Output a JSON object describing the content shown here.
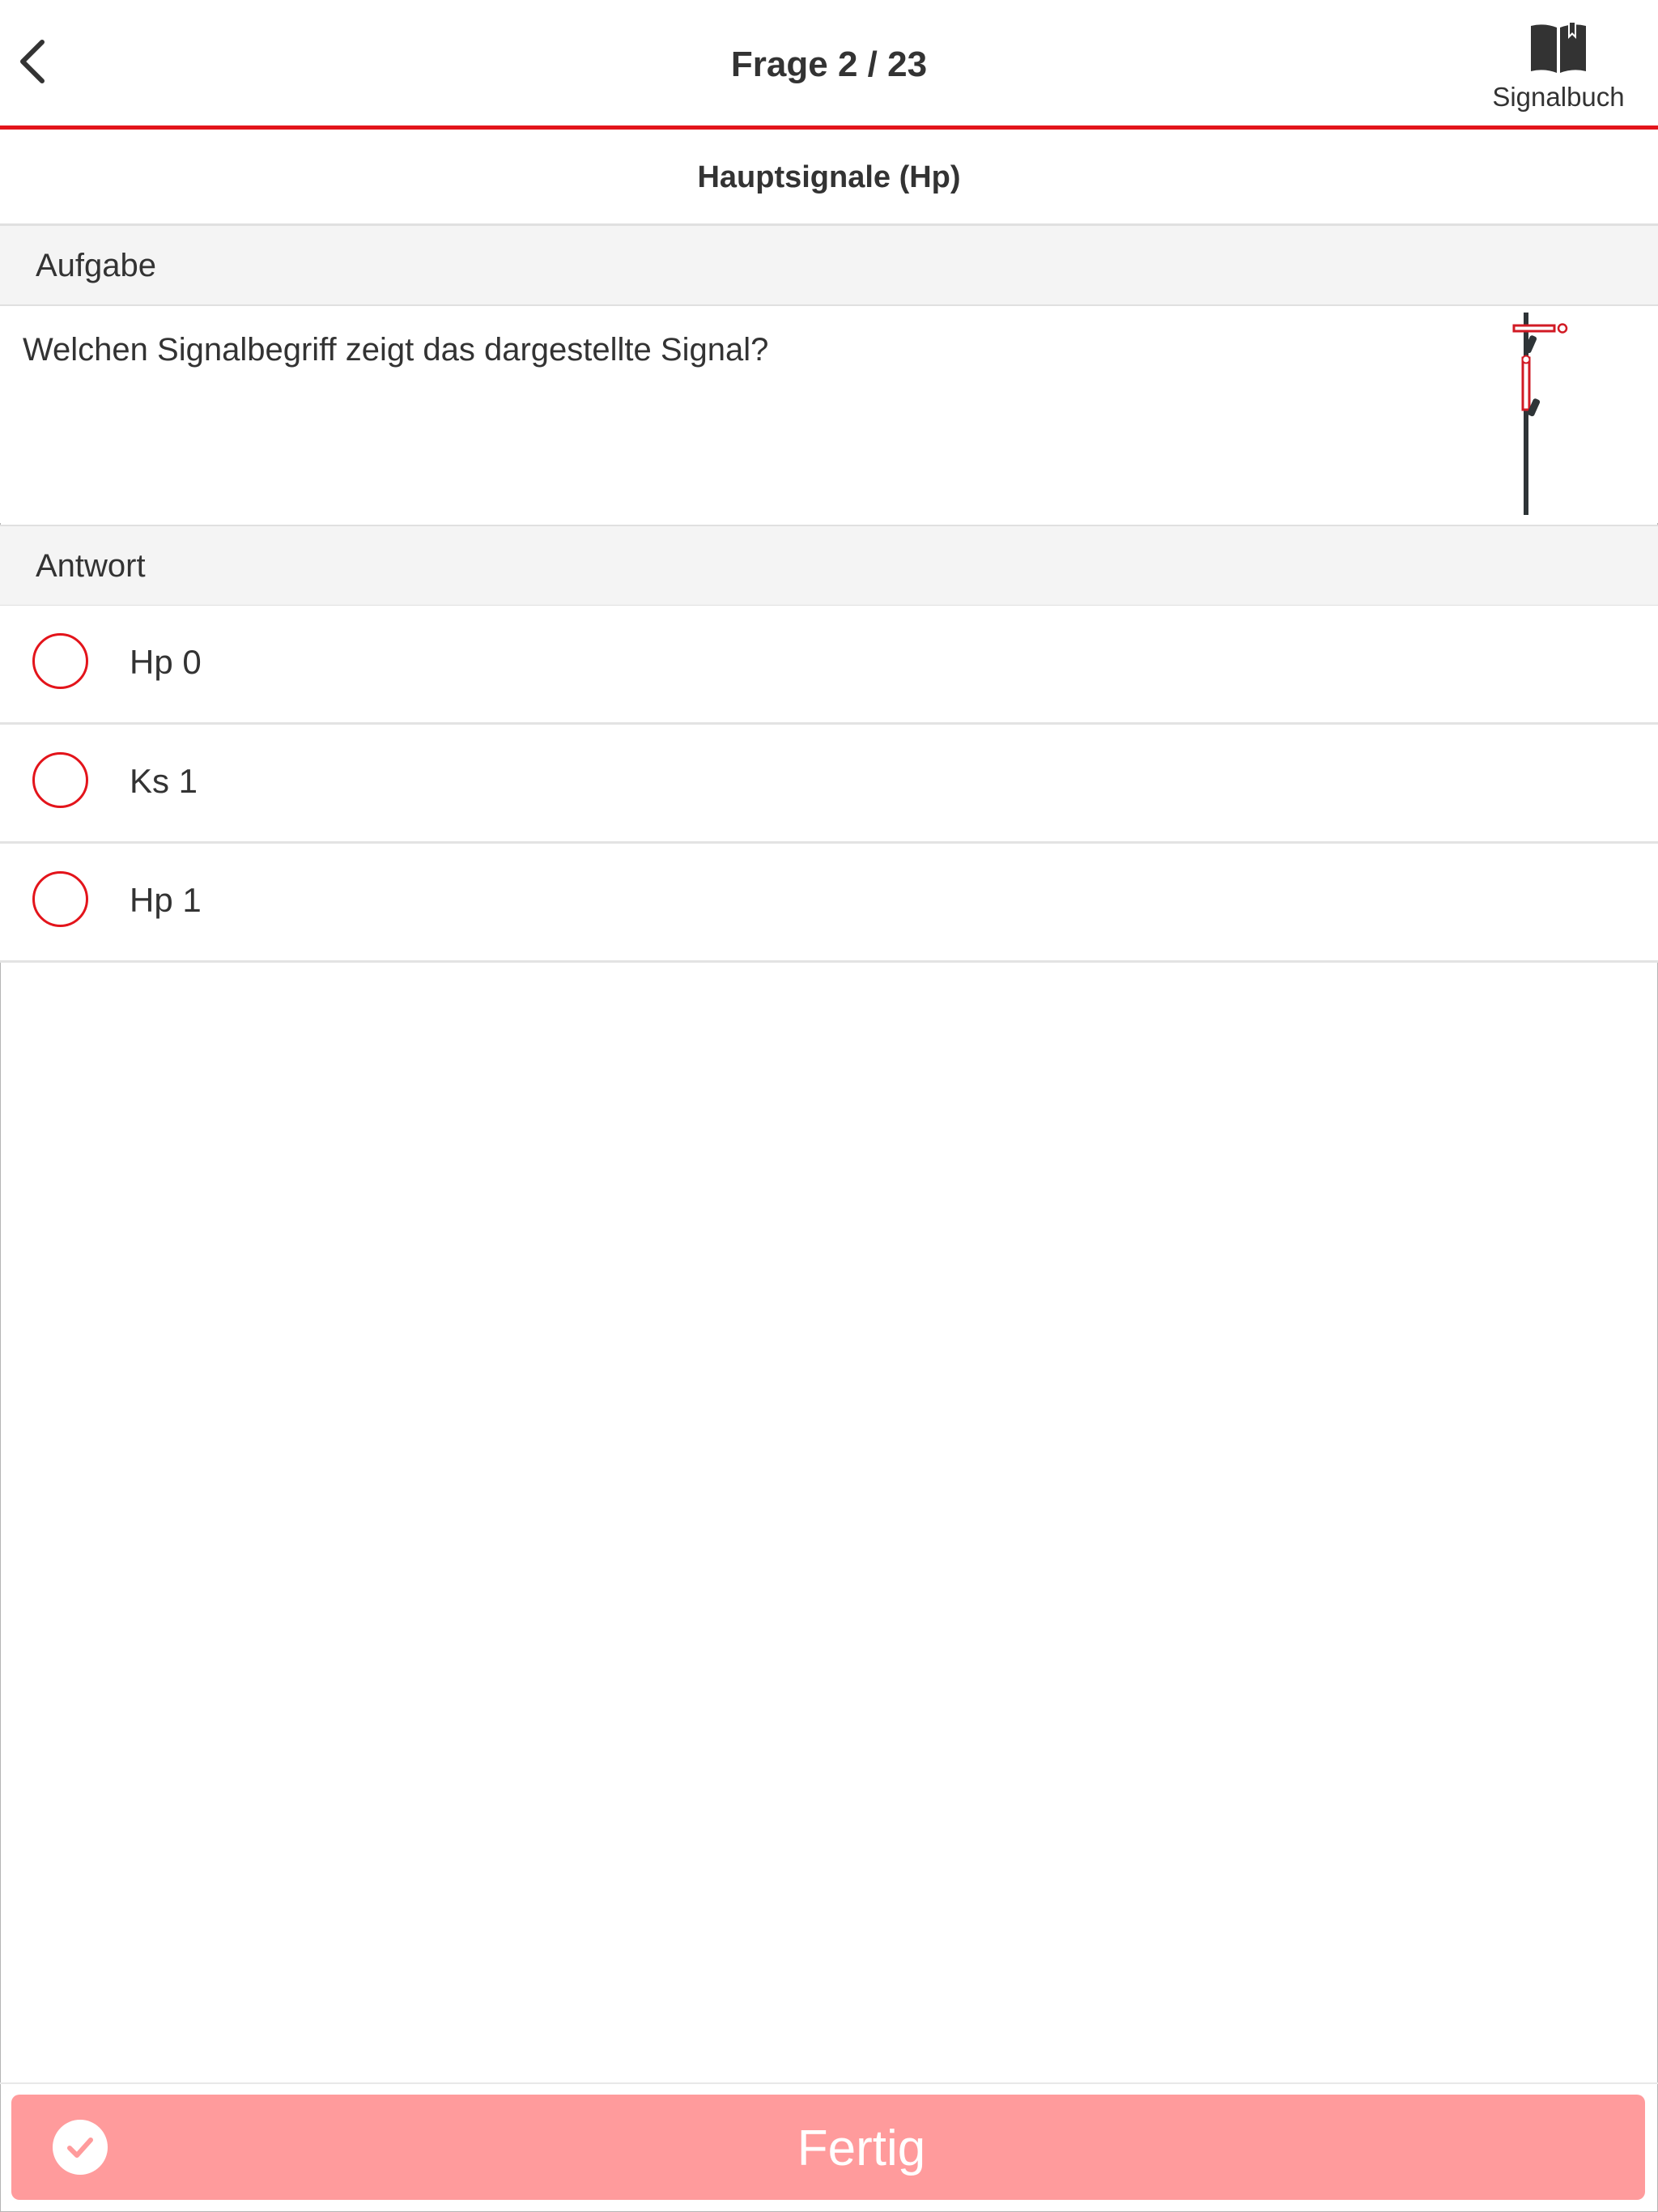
{
  "header": {
    "title": "Frage 2 / 23",
    "signalbuch_label": "Signalbuch"
  },
  "category": {
    "title": "Hauptsignale (Hp)"
  },
  "aufgabe": {
    "section_label": "Aufgabe",
    "question": "Welchen Signalbegriff zeigt das dargestellte Signal?"
  },
  "antwort": {
    "section_label": "Antwort",
    "options": [
      {
        "label": "Hp 0",
        "selected": false
      },
      {
        "label": "Ks 1",
        "selected": false
      },
      {
        "label": "Hp 1",
        "selected": false
      }
    ]
  },
  "footer": {
    "done_label": "Fertig"
  },
  "colors": {
    "accent": "#e3141b",
    "button_disabled": "#ff9b9c",
    "section_bg": "#f4f4f4",
    "text": "#333333"
  },
  "icons": {
    "back": "chevron-left-icon",
    "signalbuch": "book-icon",
    "done": "checkmark-circle-icon"
  }
}
